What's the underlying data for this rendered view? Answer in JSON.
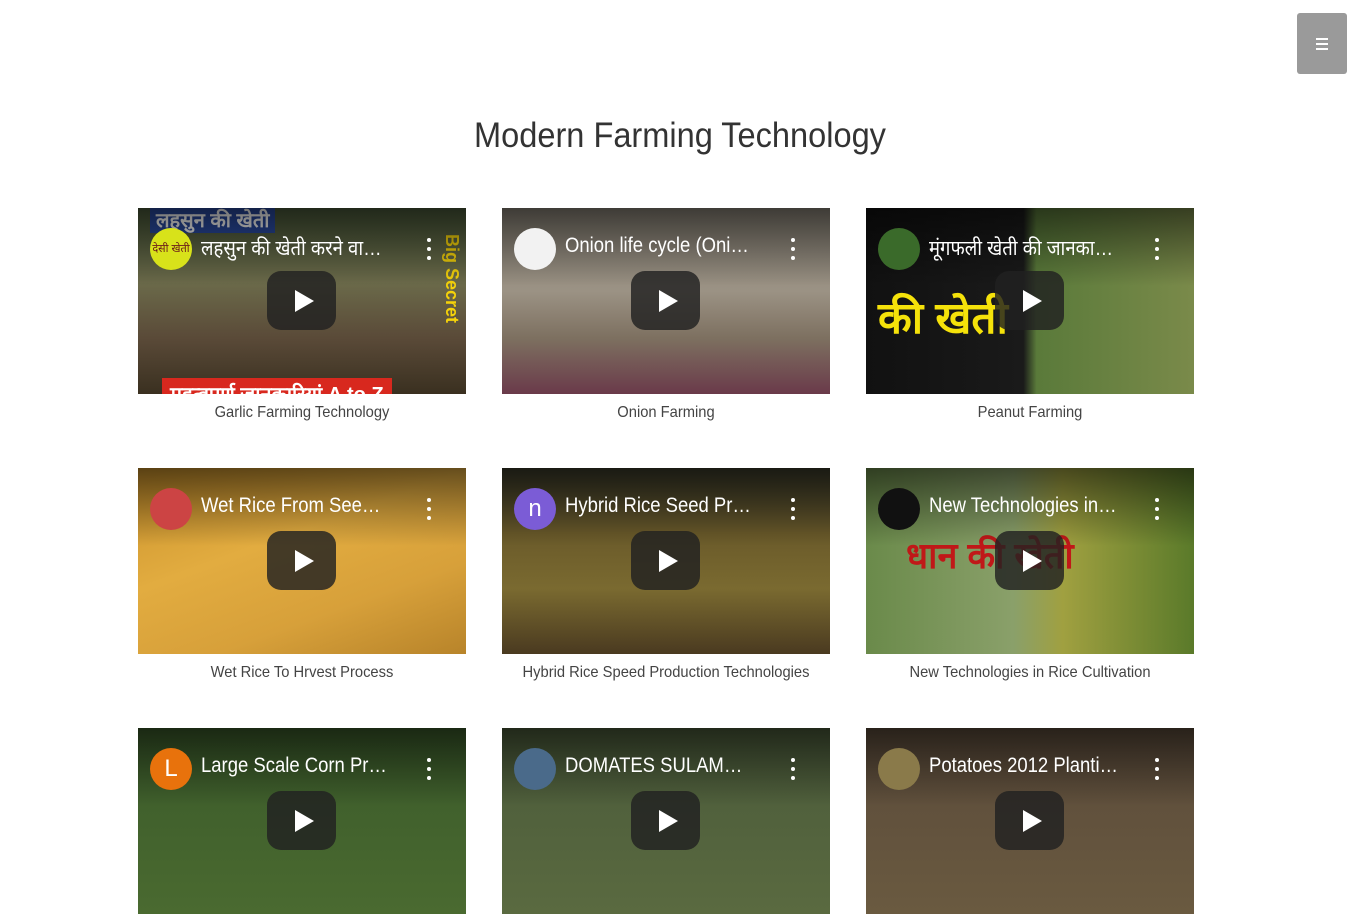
{
  "header": {
    "menu_icon": "hamburger-icon"
  },
  "page": {
    "title": "Modern Farming Technology"
  },
  "videos": [
    {
      "title": "लहसुन की खेती करने वाले ...",
      "caption": "Garlic Farming Technology",
      "channel_initial": "देसी खेती",
      "channel_color": "#d8e21a",
      "bg": "linear-gradient(180deg,#4a5a3a 0%,#6b6a4a 40%,#5a4a38 70%,#3a3020 100%)",
      "overlay_top": "लहसुन की खेती",
      "overlay_side": "Big Secret",
      "overlay_bottom": "महत्वपूर्ण जानकारियां A to Z"
    },
    {
      "title": "Onion life cycle (Onion f...",
      "caption": "Onion Farming",
      "channel_initial": "",
      "channel_color": "#f2f2f2",
      "bg": "linear-gradient(180deg,#8a8478 0%,#9b9284 45%,#7d7060 70%,#6a3a4a 100%)"
    },
    {
      "title": "मूंगफली खेती की जानकारी ...",
      "caption": "Peanut Farming",
      "channel_initial": "",
      "channel_color": "#3a6a2a",
      "bg": "linear-gradient(90deg,#111 0%,#1a1a1a 48%,#5a7a3a 52%,#7a8a4a 100%)",
      "overlay_top": "की खेती"
    },
    {
      "title": "Wet Rice From Seed To ...",
      "caption": "Wet Rice To Hrvest Process",
      "channel_initial": "",
      "channel_color": "#c44",
      "bg": "linear-gradient(160deg,#c8902a 0%,#e2ac40 40%,#d7a03a 70%,#b8842a 100%)"
    },
    {
      "title": "Hybrid Rice Seed Produ...",
      "caption": "Hybrid Rice Speed Production Technologies",
      "channel_initial": "n",
      "channel_color": "#7b5cd6",
      "bg": "linear-gradient(180deg,#3a3a2a 0%,#6a5a2a 35%,#7a6a30 65%,#4a3a20 100%)"
    },
    {
      "title": "New Technologies in Ri...",
      "caption": "New Technologies in Rice Cultivation",
      "channel_initial": "",
      "channel_color": "#111",
      "bg": "linear-gradient(90deg,#6a8a4a 0%,#8aa06a 45%,#a0a040 60%,#5a7a2a 100%)",
      "overlay_top": "धान की खेती"
    },
    {
      "title": "Large Scale Corn Produ...",
      "caption": "",
      "channel_initial": "L",
      "channel_color": "#e8720c",
      "bg": "linear-gradient(180deg,#3a5a2a 0%,#4a6a30 100%)"
    },
    {
      "title": "DOMATES SULAMASIN...",
      "caption": "",
      "channel_initial": "",
      "channel_color": "#4a6a8a",
      "bg": "linear-gradient(180deg,#4a5a3a 0%,#5a6a40 100%)"
    },
    {
      "title": "Potatoes 2012 Planting...",
      "caption": "",
      "channel_initial": "",
      "channel_color": "#8a7a4a",
      "bg": "linear-gradient(180deg,#5a4a3a 0%,#6a5a40 100%)"
    }
  ]
}
